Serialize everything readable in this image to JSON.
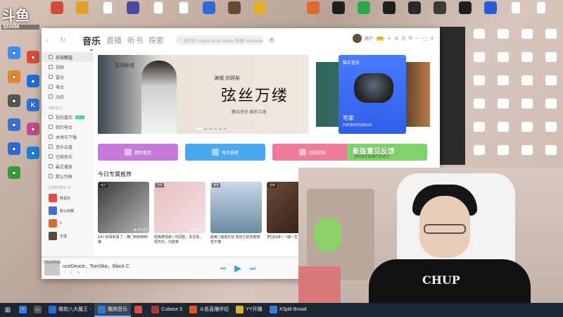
{
  "stream": {
    "logo": "斗鱼",
    "room_id": "323456"
  },
  "desktop_left": [
    {
      "label": "",
      "color": "#3c8cff",
      "glyph": "●"
    },
    {
      "label": "",
      "color": "#d94b3a",
      "glyph": "●"
    },
    {
      "label": "",
      "color": "#e08a2a",
      "glyph": "●"
    },
    {
      "label": "",
      "color": "#1e6ed8",
      "glyph": "●"
    },
    {
      "label": "",
      "color": "#555",
      "glyph": "●"
    },
    {
      "label": "",
      "color": "#2f6fdc",
      "glyph": "K"
    },
    {
      "label": "",
      "color": "#3b6fd0",
      "glyph": "●"
    },
    {
      "label": "",
      "color": "#c24b8a",
      "glyph": "●"
    },
    {
      "label": "",
      "color": "#2a6ad8",
      "glyph": "●"
    },
    {
      "label": "",
      "color": "#1e7ed8",
      "glyph": "●"
    },
    {
      "label": "",
      "color": "#3a9a3a",
      "glyph": "●"
    }
  ],
  "desktop_top": [
    {
      "label": "",
      "color": "#d24c3a"
    },
    {
      "label": "",
      "color": "#e0a02a"
    },
    {
      "label": "",
      "color": "#ffffff"
    },
    {
      "label": "",
      "color": "#4a4aa0"
    },
    {
      "label": "",
      "color": "#ffffff"
    },
    {
      "label": "",
      "color": "#ffffff"
    },
    {
      "label": "",
      "color": "#2c6bd9"
    },
    {
      "label": "",
      "color": "#6a4a30"
    },
    {
      "label": "",
      "color": "#e0b02a"
    },
    {
      "label": "",
      "color": "#e06a2a"
    },
    {
      "label": "",
      "color": "#1e1e1e"
    },
    {
      "label": "",
      "color": "#2aa84a"
    },
    {
      "label": "",
      "color": "#1e1e1e"
    },
    {
      "label": "",
      "color": "#2a2a2a"
    },
    {
      "label": "",
      "color": "#3a3a3a"
    },
    {
      "label": "",
      "color": "#1e1e1e"
    },
    {
      "label": "",
      "color": "#2a5ad8"
    },
    {
      "label": "",
      "color": "#ffffff"
    },
    {
      "label": "",
      "color": "#ffffff"
    }
  ],
  "app": {
    "tabs": [
      {
        "label": "音乐",
        "selected": true
      },
      {
        "label": "直播"
      },
      {
        "label": "听书"
      },
      {
        "label": "探索"
      }
    ],
    "search_placeholder": "周杰伦 Angela Mind Words 热搜Facebook",
    "user_name": "用户",
    "vip_label": "VIP",
    "window_buttons": [
      "⧉",
      "—",
      "▢",
      "✕"
    ],
    "sidebar": {
      "nav": [
        {
          "label": "乐馆精选",
          "selected": true
        },
        {
          "label": "视频"
        },
        {
          "label": "雷达"
        },
        {
          "label": "电台"
        },
        {
          "label": "动态"
        }
      ],
      "my_music_head": "我的音乐",
      "my_music": [
        {
          "label": "我的喜欢",
          "badge": "NEW"
        },
        {
          "label": "我的电台"
        },
        {
          "label": "本地与下载"
        },
        {
          "label": "音乐云盘"
        },
        {
          "label": "已购音乐"
        },
        {
          "label": "最近播放"
        },
        {
          "label": "默认列表"
        }
      ],
      "playlist_head": "创建的歌单 12",
      "playlists": [
        {
          "label": "我喜欢",
          "color": "#e94b4b"
        },
        {
          "label": "默认收藏",
          "color": "#4a6ad8"
        },
        {
          "label": "1",
          "color": "#d86a3a"
        },
        {
          "label": "华语",
          "color": "#5a4a40"
        }
      ]
    },
    "banner": {
      "logo": "国风新语",
      "subtitle": "演唱 刘珂矣",
      "title": "弦丝万缕",
      "desc": "腾讯音乐 国乐江南"
    },
    "promo": {
      "title": "猫王音乐",
      "name": "宅家",
      "desc": "开启游戏专属BGM"
    },
    "quick": [
      {
        "label": "猜你喜欢",
        "color": "#c87ad8"
      },
      {
        "label": "每日推荐",
        "color": "#4aa8f0"
      },
      {
        "label": "动态壁纸",
        "color": "#f07a9a"
      }
    ],
    "feedback": {
      "title": "新版意见反馈",
      "sub": "您的意见是我们的动力"
    },
    "section_title": "今日专属推荐",
    "cards": [
      {
        "tag": "电子",
        "count": "153.4万",
        "title": "EA7 刺耳刺耳了，嗷门刺到到刺嗷",
        "bg": "linear-gradient(135deg,#3a3a3a,#b8b8b8)"
      },
      {
        "tag": "经典",
        "count": "311.6万",
        "title": "经典老情歌 | 可回首，多往事，周杰伦，刘若英",
        "bg": "linear-gradient(135deg,#e8c0c0,#f4e0e4)"
      },
      {
        "tag": "翻唱",
        "count": "",
        "title": "欧美 | 摇滚乐坛 有自己的态度感觉不懂",
        "bg": "linear-gradient(180deg,#c8d8e8,#6a8aa0)"
      },
      {
        "tag": "经典",
        "count": "",
        "title": "梦回仙侠 | 一曲一生",
        "bg": "linear-gradient(135deg,#6a4a3a,#2a1a12)"
      }
    ],
    "player": {
      "song": "uceDeuce，TomSka，Black C",
      "label": "Circusfeud"
    }
  },
  "taskbar": {
    "items": [
      {
        "label": "微软八大魔王 -",
        "color": "#2a6ad8",
        "active": false
      },
      {
        "label": "酷狗音乐",
        "color": "#2a7ad8",
        "active": true
      },
      {
        "label": "",
        "color": "#e04a4a",
        "active": false
      },
      {
        "label": "Cubase 5",
        "color": "#a83a3a",
        "active": false
      },
      {
        "label": "斗鱼直播伴侣",
        "color": "#e0542a",
        "active": false
      },
      {
        "label": "YY开播",
        "color": "#e0b02a",
        "active": false
      },
      {
        "label": "XSplit Broad",
        "color": "#3a7ad8",
        "active": false
      }
    ]
  },
  "webcam": {
    "shirt_text": "CHUP"
  }
}
